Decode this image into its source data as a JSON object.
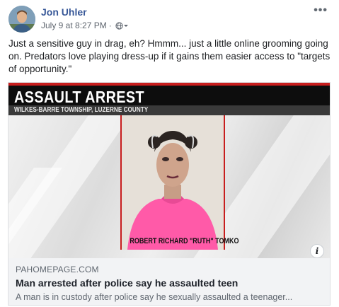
{
  "post": {
    "author": "Jon Uhler",
    "timestamp": "July 9 at 8:27 PM",
    "separator": "·",
    "audience_icon": "globe-icon",
    "more_label": "•••",
    "text": "Just a sensitive guy in drag, eh? Hmmm... just a little online grooming going on. Predators love playing dress-up if it gains them easier access to \"targets of opportunity.\""
  },
  "link_preview": {
    "image": {
      "headline": "ASSAULT ARREST",
      "subheadline": "WILKES-BARRE TOWNSHIP, LUZERNE COUNTY",
      "caption": "ROBERT RICHARD \"RUTH\" TOMKO"
    },
    "info_label": "i",
    "domain": "PAHOMEPAGE.COM",
    "title": "Man arrested after police say he assaulted teen",
    "description": "A man is in custody after police say he sexually assaulted a teenager..."
  },
  "colors": {
    "author": "#385898",
    "meta": "#606770",
    "news_red": "#c81e1e",
    "link_bg": "#f2f3f5",
    "shirt_pink": "#ff5aa8"
  }
}
